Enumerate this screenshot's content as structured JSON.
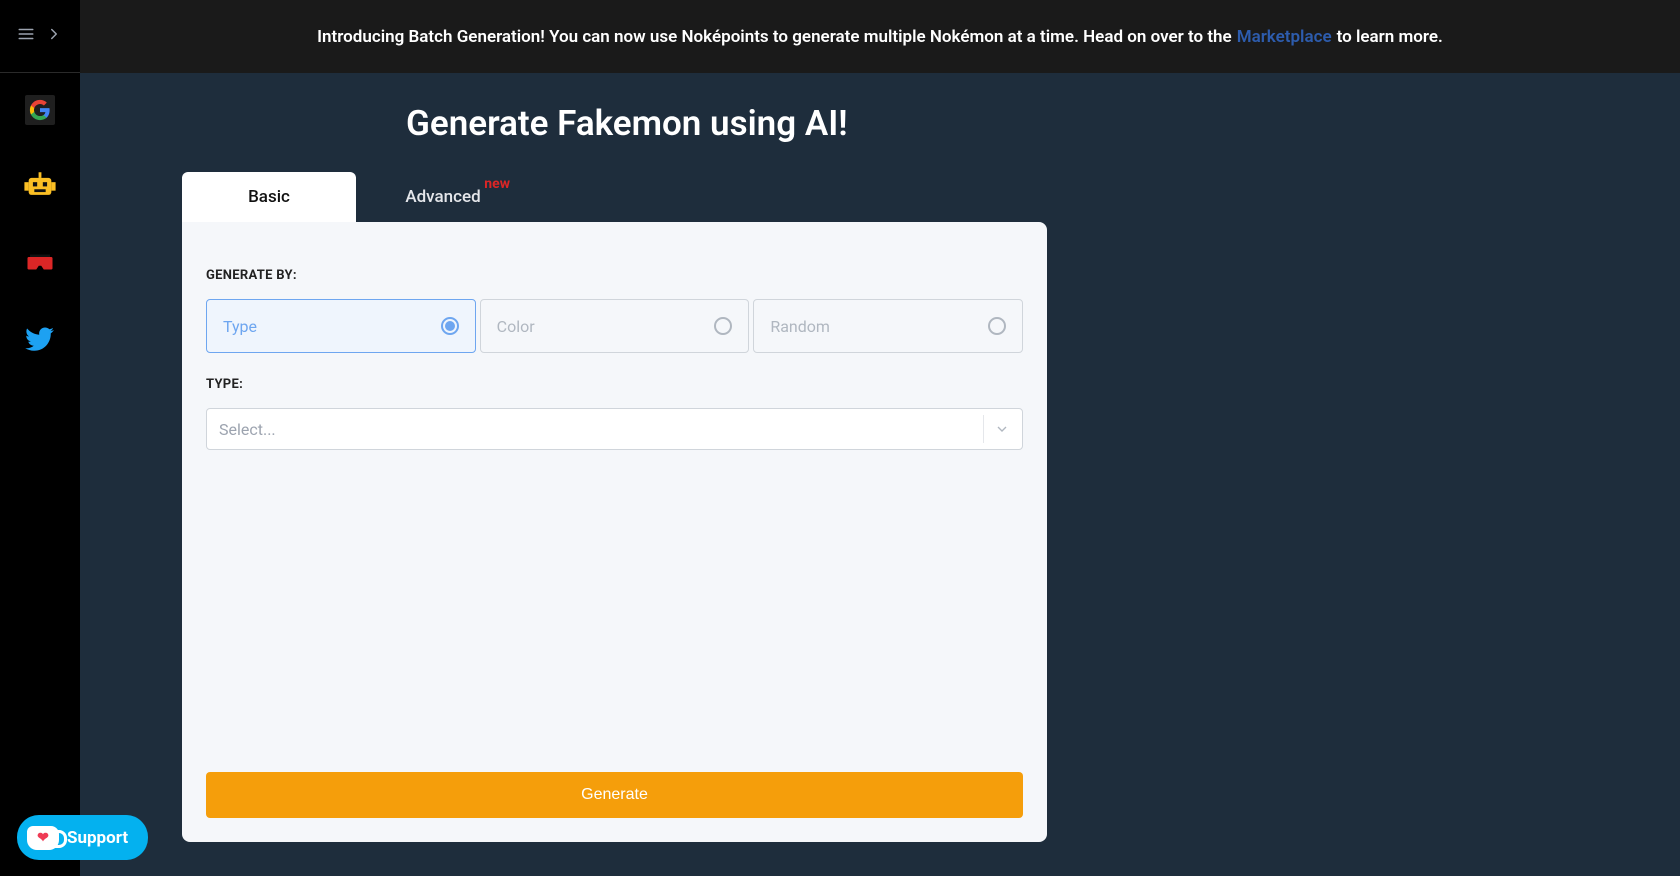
{
  "banner": {
    "text_before": "Introducing Batch Generation! You can now use Noképoints to generate multiple Nokémon at a time. Head on over to the ",
    "link_text": "Marketplace",
    "text_after": " to learn more."
  },
  "page": {
    "title": "Generate Fakemon using AI!"
  },
  "tabs": {
    "basic": "Basic",
    "advanced": "Advanced",
    "badge": "new"
  },
  "form": {
    "generate_by_label": "GENERATE BY:",
    "options": {
      "type": "Type",
      "color": "Color",
      "random": "Random"
    },
    "type_label": "TYPE:",
    "select_placeholder": "Select...",
    "generate_button": "Generate"
  },
  "support": {
    "label": "Support"
  }
}
